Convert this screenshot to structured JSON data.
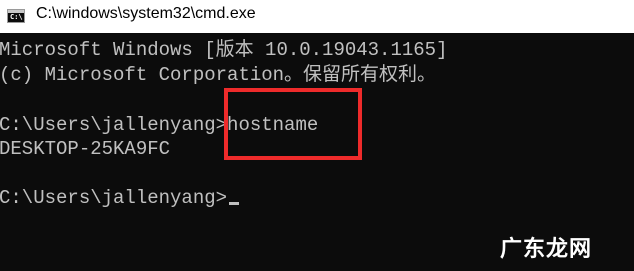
{
  "window": {
    "title": "C:\\windows\\system32\\cmd.exe",
    "icon": "command-prompt-icon",
    "icon_glyph": "C:\\"
  },
  "console": {
    "lines": [
      "Microsoft Windows [版本 10.0.19043.1165]",
      "(c) Microsoft Corporation。保留所有权利。",
      "",
      "C:\\Users\\jallenyang>hostname",
      "DESKTOP-25KA9FC",
      "",
      "C:\\Users\\jallenyang>"
    ],
    "text_color": "#c0c0c0",
    "background_color": "#0c0c0c"
  },
  "annotation": {
    "highlight_color": "#ef2b2b"
  },
  "watermark": {
    "text": "广东龙网"
  }
}
